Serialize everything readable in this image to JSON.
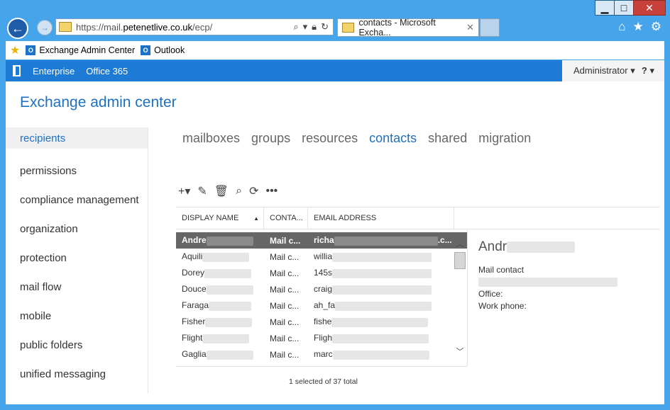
{
  "browser": {
    "url_host": "https://mail.",
    "url_domain": "petenetlive.co.uk",
    "url_path": "/ecp/",
    "tab_title": "contacts - Microsoft Excha...",
    "tab_close": "✕"
  },
  "window_controls": {
    "minimize": "▁",
    "maximize": "□",
    "close": "✕"
  },
  "favorites": [
    {
      "label": "Exchange Admin Center"
    },
    {
      "label": "Outlook"
    }
  ],
  "topnav": {
    "enterprise": "Enterprise",
    "office365": "Office 365",
    "admin": "Administrator",
    "help": "?"
  },
  "page_title": "Exchange admin center",
  "left_nav": [
    "recipients",
    "permissions",
    "compliance management",
    "organization",
    "protection",
    "mail flow",
    "mobile",
    "public folders",
    "unified messaging"
  ],
  "sub_tabs": [
    "mailboxes",
    "groups",
    "resources",
    "contacts",
    "shared",
    "migration"
  ],
  "grid": {
    "headers": [
      "DISPLAY NAME",
      "CONTA...",
      "EMAIL ADDRESS"
    ],
    "rows": [
      {
        "name": "Andre",
        "type": "Mail c...",
        "email": "richa",
        "email_tail": ".c..."
      },
      {
        "name": "Aquili",
        "type": "Mail c...",
        "email": "willia"
      },
      {
        "name": "Dorey",
        "type": "Mail c...",
        "email": "145s"
      },
      {
        "name": "Douce",
        "type": "Mail c...",
        "email": "craig"
      },
      {
        "name": "Faraga",
        "type": "Mail c...",
        "email": "ah_fa"
      },
      {
        "name": "Fisher",
        "type": "Mail c...",
        "email": "fishe"
      },
      {
        "name": "Flight",
        "type": "Mail c...",
        "email": "Fligh"
      },
      {
        "name": "Gaglia",
        "type": "Mail c...",
        "email": "marc"
      }
    ]
  },
  "detail": {
    "name": "Andr",
    "type": "Mail contact",
    "office_label": "Office:",
    "phone_label": "Work phone:"
  },
  "status": "1 selected of 37 total"
}
